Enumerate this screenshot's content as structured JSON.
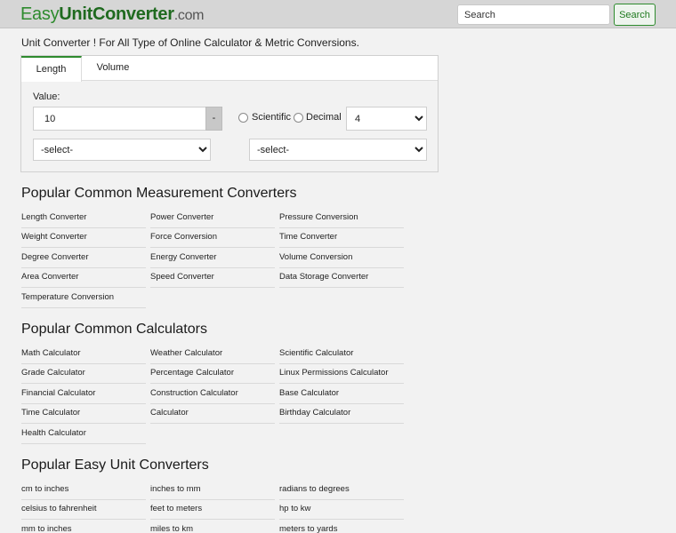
{
  "header": {
    "logo_part1": "Easy",
    "logo_part2": "UnitConverter",
    "logo_part3": ".com",
    "search_placeholder": "Search",
    "search_button": "Search"
  },
  "tagline": "Unit Converter ! For All Type of Online Calculator & Metric Conversions.",
  "converter": {
    "tabs": [
      "Length",
      "Volume"
    ],
    "value_label": "Value:",
    "value": "10",
    "minus_label": "-",
    "radio_scientific": "Scientific",
    "radio_decimal": "Decimal",
    "precision": "4",
    "from_unit": "-select-",
    "to_unit": "-select-"
  },
  "sections": [
    {
      "title": "Popular Common Measurement Converters",
      "links": [
        [
          "Length Converter",
          "Power Converter",
          "Pressure Conversion"
        ],
        [
          "Weight Converter",
          "Force Conversion",
          "Time Converter"
        ],
        [
          "Degree Converter",
          "Energy Converter",
          "Volume Conversion"
        ],
        [
          "Area Converter",
          "Speed Converter",
          "Data Storage Converter"
        ],
        [
          "Temperature Conversion"
        ]
      ]
    },
    {
      "title": "Popular Common Calculators",
      "links": [
        [
          "Math Calculator",
          "Weather Calculator",
          "Scientific Calculator"
        ],
        [
          "Grade Calculator",
          "Percentage Calculator",
          "Linux Permissions Calculator"
        ],
        [
          "Financial Calculator",
          "Construction Calculator",
          "Base Calculator"
        ],
        [
          "Time Calculator",
          "Calculator",
          "Birthday Calculator"
        ],
        [
          "Health Calculator"
        ]
      ]
    },
    {
      "title": "Popular Easy Unit Converters",
      "links": [
        [
          "cm to inches",
          "inches to mm",
          "radians to degrees"
        ],
        [
          "celsius to fahrenheit",
          "feet to meters",
          "hp to kw"
        ],
        [
          "mm to inches",
          "miles to km",
          "meters to yards"
        ]
      ]
    }
  ]
}
